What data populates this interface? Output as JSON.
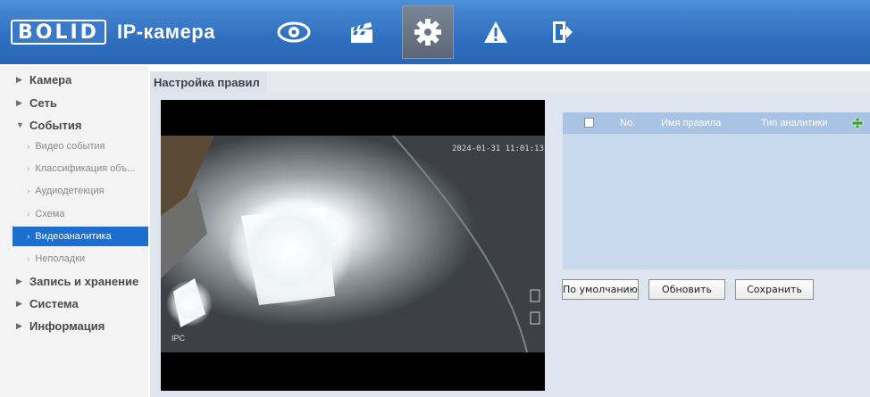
{
  "header": {
    "logo_text": "BOLID",
    "title": "IP-камера",
    "nav": [
      {
        "icon": "eye-icon"
      },
      {
        "icon": "clapperboard-icon"
      },
      {
        "icon": "gear-icon"
      },
      {
        "icon": "warning-icon"
      },
      {
        "icon": "logout-icon"
      }
    ],
    "active_nav": "gear-icon"
  },
  "sidebar": {
    "items": [
      {
        "label": "Камера",
        "level": "top",
        "expanded": false
      },
      {
        "label": "Сеть",
        "level": "top",
        "expanded": false
      },
      {
        "label": "События",
        "level": "top",
        "expanded": true
      },
      {
        "label": "Видео события",
        "level": "sub"
      },
      {
        "label": "Классификация объ...",
        "level": "sub"
      },
      {
        "label": "Аудиодетекция",
        "level": "sub"
      },
      {
        "label": "Схема",
        "level": "sub"
      },
      {
        "label": "Видеоаналитика",
        "level": "sub",
        "active": true
      },
      {
        "label": "Неполадки",
        "level": "sub"
      },
      {
        "label": "Запись и хранение",
        "level": "top",
        "expanded": false
      },
      {
        "label": "Система",
        "level": "top",
        "expanded": false
      },
      {
        "label": "Информация",
        "level": "top",
        "expanded": false
      }
    ]
  },
  "main": {
    "tab_label": "Настройка правил",
    "video": {
      "timestamp": "2024-01-31 11:01:13",
      "ir_label": "IPC"
    },
    "rules_table": {
      "columns": [
        "No.",
        "Имя правила",
        "Тип аналитики"
      ],
      "rows": []
    },
    "buttons": {
      "default": "По умолчанию",
      "refresh": "Обновить",
      "save": "Сохранить"
    }
  }
}
